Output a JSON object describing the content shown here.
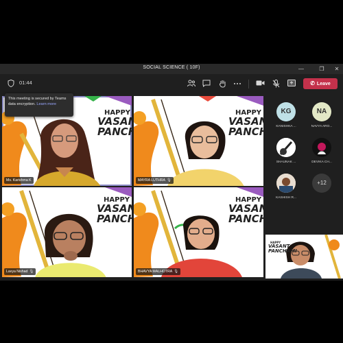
{
  "window": {
    "title": "SOCIAL SCIENCE ( 10F)",
    "controls": {
      "minimize": "—",
      "restore": "❐",
      "close": "✕"
    }
  },
  "toolbar": {
    "timer": "01:44",
    "leave_label": "Leave",
    "icons": [
      "shield-icon",
      "people-icon",
      "chat-icon",
      "raise-hand-icon",
      "more-icon",
      "camera-icon",
      "mic-off-icon",
      "share-icon",
      "phone-icon"
    ]
  },
  "tooltip": {
    "text": "This meeting is secured by Teams data encryption.",
    "link": "Learn more"
  },
  "tiles": [
    {
      "name": "Ms. Karishma K",
      "banner": [
        "HAPPY",
        "VASANT",
        "PANCHA"
      ]
    },
    {
      "name": "MAYRA LUTHRA",
      "banner": [
        "HAPPY",
        "VASANT",
        "PANCHA"
      ]
    },
    {
      "name": "Lavya Nishad",
      "banner": [
        "HAPPY",
        "VASANT",
        "PANCHA"
      ]
    },
    {
      "name": "BHAVYA MALHOTRA",
      "banner": [
        "HAPPY",
        "VASANT",
        "PANCHA"
      ]
    }
  ],
  "participants": [
    {
      "initials": "KG",
      "name": "KANISHKA ...",
      "color": "#bfe0e6"
    },
    {
      "initials": "NA",
      "name": "NAVYA ARO...",
      "color": "#e3e8c6"
    },
    {
      "initials": "",
      "name": "SHAUNAK ...",
      "color": "#ffffff"
    },
    {
      "initials": "",
      "name": "DEVIKA CH...",
      "color": "#1a1a1a"
    },
    {
      "initials": "",
      "name": "KASHISH R...",
      "color": "#d9c7b0"
    }
  ],
  "more_count": "+12",
  "small_tile_banner": [
    "HAPPY",
    "VASANT",
    "PANCHAMI"
  ]
}
